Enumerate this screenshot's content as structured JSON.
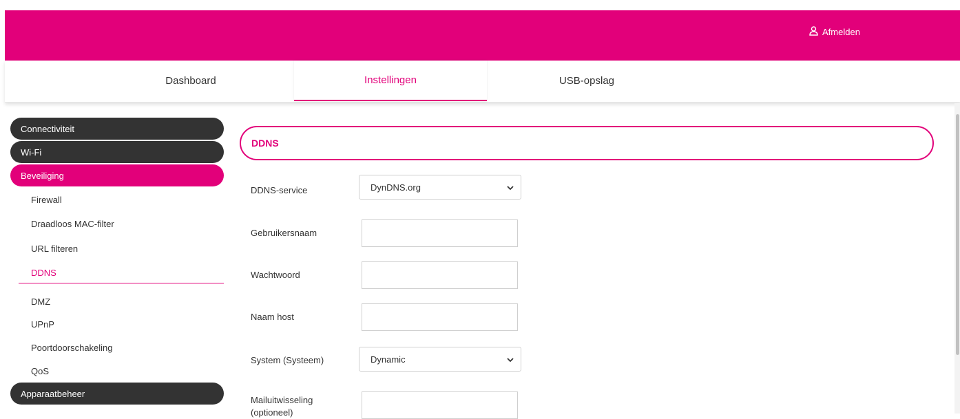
{
  "header": {
    "logout_label": "Afmelden",
    "logout_icon": "user-icon",
    "brand_color": "#e2007a"
  },
  "nav": {
    "tabs": [
      {
        "label": "Dashboard",
        "active": false
      },
      {
        "label": "Instellingen",
        "active": true
      },
      {
        "label": "USB-opslag",
        "active": false
      }
    ]
  },
  "sidebar": {
    "sections": [
      {
        "label": "Connectiviteit"
      },
      {
        "label": "Wi-Fi"
      },
      {
        "label": "Beveiliging",
        "active": true
      },
      {
        "label": "Apparaatbeheer"
      }
    ],
    "items": [
      {
        "label": "Firewall"
      },
      {
        "label": "Draadloos MAC-filter"
      },
      {
        "label": "URL filteren"
      },
      {
        "label": "DDNS",
        "active": true
      },
      {
        "label": "DMZ"
      },
      {
        "label": "UPnP"
      },
      {
        "label": "Poortdoorschakeling"
      },
      {
        "label": "QoS"
      }
    ]
  },
  "content": {
    "title": "DDNS",
    "fields": {
      "service": {
        "label": "DDNS-service",
        "value": "DynDNS.org"
      },
      "username": {
        "label": "Gebruikersnaam",
        "value": ""
      },
      "password": {
        "label": "Wachtwoord",
        "value": ""
      },
      "hostname": {
        "label": "Naam host",
        "value": ""
      },
      "system": {
        "label": "System (Systeem)",
        "value": "Dynamic"
      },
      "mx_line1": "Mailuitwisseling",
      "mx_line2": "(optioneel)",
      "mx_value": ""
    }
  }
}
